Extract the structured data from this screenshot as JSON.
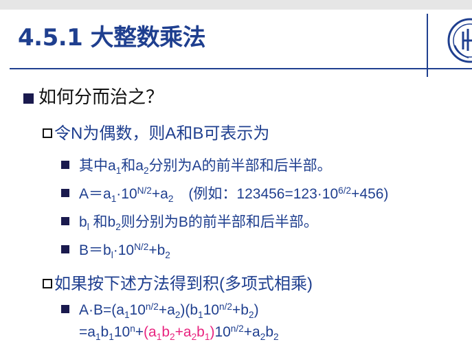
{
  "slide": {
    "title": "4.5.1 大整数乘法"
  },
  "body": {
    "q1": "如何分而治之？",
    "q1_sub": "令N为偶数，则A和B可表示为",
    "item1": {
      "a": "其中a",
      "b": "1",
      "c": "和a",
      "d": "2",
      "e": "分别为A的前半部和后半部。"
    },
    "item2": {
      "a": "A＝a",
      "b": "1",
      "c": "·10",
      "d": "N/2",
      "e": "+a",
      "f": "2",
      "g": "(例如：123456=123·10",
      "h": "6/2",
      "i": "+456)"
    },
    "item3": {
      "a": "b",
      "b": "l",
      "c": " 和b",
      "d": "2",
      "e": "则分别为B的前半部和后半部。"
    },
    "item4": {
      "a": "B＝b",
      "b": "l",
      "c": "·10",
      "d": "N/2",
      "e": "+b",
      "f": "2"
    },
    "q2": "如果按下述方法得到积(多项式相乘)",
    "formula1": {
      "a": "A·B=(a",
      "b": "1",
      "c": "10",
      "d": "n/2",
      "e": "+a",
      "f": "2",
      "g": ")(b",
      "h": "1",
      "i": "10",
      "j": "n/2",
      "k": "+b",
      "l": "2",
      "m": ")"
    },
    "formula2": {
      "a": "=a",
      "b": "1",
      "c": "b",
      "d": "1",
      "e": "10",
      "f": "n",
      "g": "+",
      "h": "(a",
      "i": "1",
      "j": "b",
      "k": "2",
      "l": "+a",
      "m": "2",
      "n": "b",
      "o": "1",
      "p": ")",
      "q": "10",
      "r": "n/2",
      "s": "+a",
      "t": "2",
      "u": "b",
      "v": "2"
    }
  },
  "colors": {
    "title": "#1f3f8f",
    "text_blue": "#1f3f8f",
    "highlight": "#e8247f"
  },
  "icons": [
    "university-seal-logo",
    "square-bullet-icon",
    "hollow-square-bullet-icon"
  ]
}
